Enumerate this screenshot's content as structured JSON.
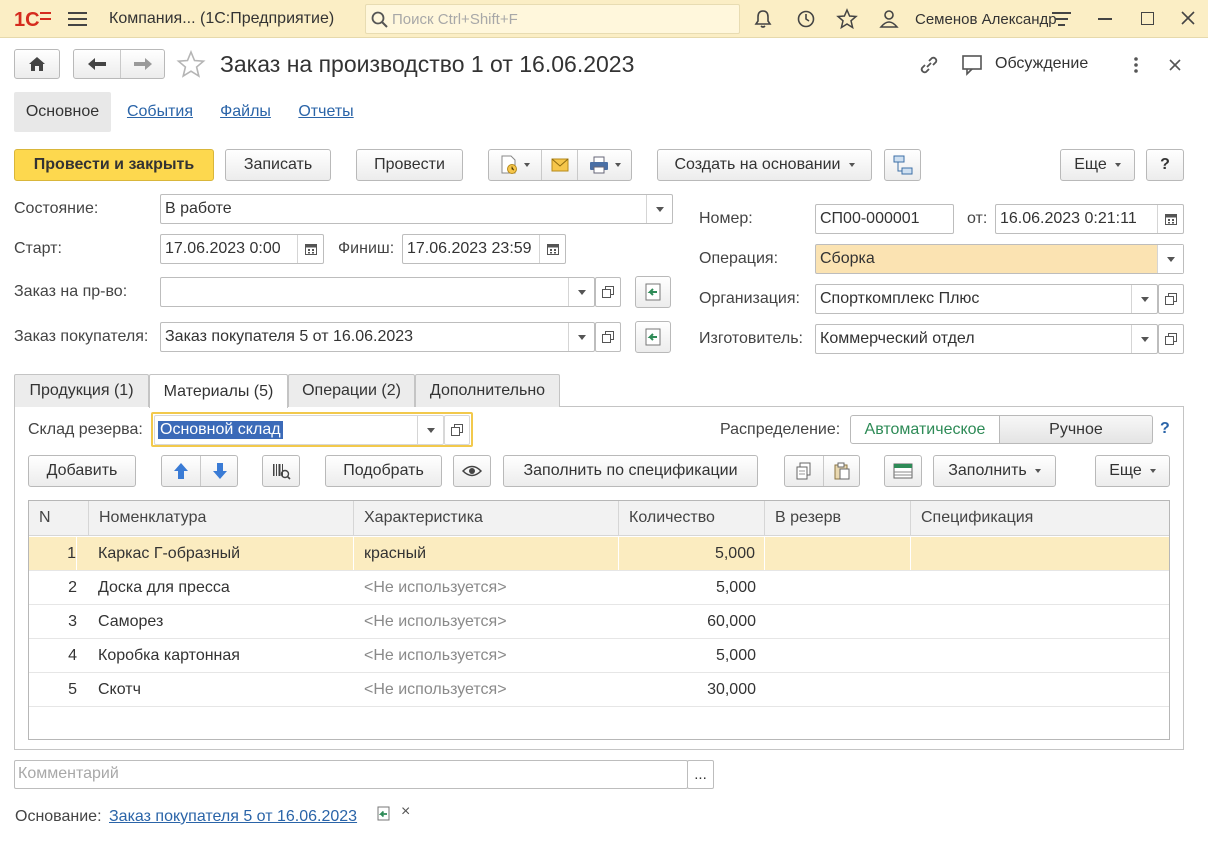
{
  "app": {
    "logo": "1С",
    "window_title": "Компания... (1С:Предприятие)",
    "search_placeholder": "Поиск Ctrl+Shift+F",
    "user": "Семенов Александр"
  },
  "doc": {
    "title": "Заказ на производство 1 от 16.06.2023",
    "discussion": "Обсуждение"
  },
  "nav_tabs": [
    "Основное",
    "События",
    "Файлы",
    "Отчеты"
  ],
  "toolbar": {
    "post_close": "Провести и закрыть",
    "save": "Записать",
    "post": "Провести",
    "create_based": "Создать на основании",
    "more": "Еще",
    "help": "?"
  },
  "form": {
    "state_label": "Состояние:",
    "state_value": "В работе",
    "start_label": "Старт:",
    "start_value": "17.06.2023  0:00",
    "finish_label": "Финиш:",
    "finish_value": "17.06.2023 23:59",
    "prod_order_label": "Заказ на пр-во:",
    "prod_order_value": "",
    "customer_order_label": "Заказ покупателя:",
    "customer_order_value": "Заказ покупателя 5 от 16.06.2023",
    "number_label": "Номер:",
    "number_value": "СП00-000001",
    "date_label": "от:",
    "date_value": "16.06.2023  0:21:11",
    "operation_label": "Операция:",
    "operation_value": "Сборка",
    "org_label": "Организация:",
    "org_value": "Спорткомплекс Плюс",
    "maker_label": "Изготовитель:",
    "maker_value": "Коммерческий отдел"
  },
  "inner_tabs": [
    "Продукция (1)",
    "Материалы (5)",
    "Операции (2)",
    "Дополнительно"
  ],
  "materials": {
    "warehouse_label": "Склад резерва:",
    "warehouse_value": "Основной склад",
    "distribution_label": "Распределение:",
    "dist_auto": "Автоматическое",
    "dist_manual": "Ручное",
    "help": "?",
    "add": "Добавить",
    "pick": "Подобрать",
    "fill_spec": "Заполнить по спецификации",
    "fill": "Заполнить",
    "more": "Еще"
  },
  "table": {
    "columns": [
      "N",
      "Номенклатура",
      "Характеристика",
      "Количество",
      "В резерв",
      "Спецификация"
    ],
    "rows": [
      {
        "n": "1",
        "item": "Каркас Г-образный",
        "char": "красный",
        "qty": "5,000",
        "reserve": "",
        "spec": ""
      },
      {
        "n": "2",
        "item": "Доска для пресса",
        "char": "<Не используется>",
        "qty": "5,000",
        "reserve": "",
        "spec": ""
      },
      {
        "n": "3",
        "item": "Саморез",
        "char": "<Не используется>",
        "qty": "60,000",
        "reserve": "",
        "spec": ""
      },
      {
        "n": "4",
        "item": "Коробка картонная",
        "char": "<Не используется>",
        "qty": "5,000",
        "reserve": "",
        "spec": ""
      },
      {
        "n": "5",
        "item": "Скотч",
        "char": "<Не используется>",
        "qty": "30,000",
        "reserve": "",
        "spec": ""
      }
    ]
  },
  "footer": {
    "comment_placeholder": "Комментарий",
    "comment_btn": "...",
    "basis_label": "Основание:",
    "basis_link": "Заказ покупателя 5 от 16.06.2023",
    "basis_clear": "×"
  },
  "colors": {
    "titlebar": "#fbeec5",
    "primary_button": "#fdd84e",
    "selected_row": "#fbecc0",
    "highlight_field": "#fbe3b2",
    "link": "#2a64a8",
    "auto_green": "#2e8b57",
    "focus_border": "#f2c94c",
    "logo_red": "#d52b1e"
  }
}
